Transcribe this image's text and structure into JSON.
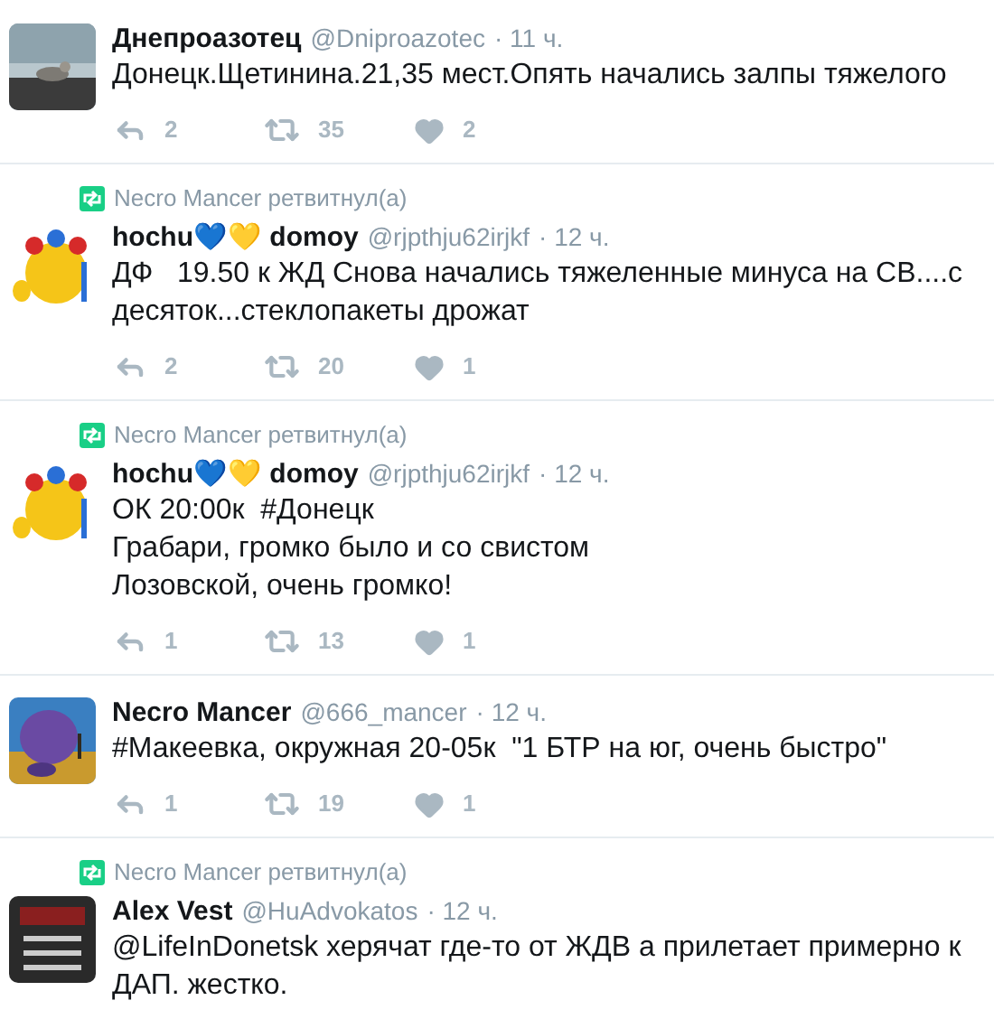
{
  "tweets": [
    {
      "name": "Днепроазотец",
      "handle": "@Dniproazotec",
      "time": "· 11 ч.",
      "text": "Донецк.Щетинина.21,35 мест.Опять начались залпы тяжелого",
      "replies": "2",
      "retweets": "35",
      "likes": "2"
    },
    {
      "retweeted_by": "Necro Mancer ретвитнул(а)",
      "name": "hochu💙💛 domoy",
      "handle": "@rjpthju62irjkf",
      "time": "· 12 ч.",
      "text": "ДФ   19.50 к ЖД Снова начались тяжеленные минуса на СВ....с десяток...стеклопакеты дрожат",
      "replies": "2",
      "retweets": "20",
      "likes": "1"
    },
    {
      "retweeted_by": "Necro Mancer ретвитнул(а)",
      "name": "hochu💙💛 domoy",
      "handle": "@rjpthju62irjkf",
      "time": "· 12 ч.",
      "text": "ОК 20:00к  #Донецк\nГрабари, громко было и со свистом\nЛозовской, очень громко!",
      "replies": "1",
      "retweets": "13",
      "likes": "1"
    },
    {
      "name": "Necro Mancer",
      "handle": "@666_mancer",
      "time": "· 12 ч.",
      "text": "#Макеевка, окружная 20-05к  \"1 БТР на юг, очень быстро\"",
      "replies": "1",
      "retweets": "19",
      "likes": "1"
    },
    {
      "retweeted_by": "Necro Mancer ретвитнул(а)",
      "name": "Alex Vest",
      "handle": "@HuAdvokatos",
      "time": "· 12 ч.",
      "text": "@LifeInDonetsk херячат где-то от ЖДВ а прилетает примерно к ДАП. жестко."
    }
  ]
}
